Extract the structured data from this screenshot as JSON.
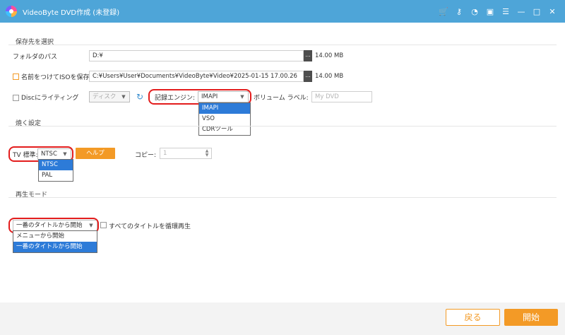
{
  "window": {
    "title": "VideoByte DVD作成 (未登録)",
    "titlebar_icons": [
      "cart-icon",
      "key-icon",
      "feedback-icon",
      "message-icon",
      "menu-icon",
      "minimize-icon",
      "maximize-icon",
      "close-icon"
    ]
  },
  "save_section": {
    "title": "保存先を選択",
    "folder_label": "フォルダのパス",
    "folder_value": "D:¥",
    "folder_size": "14.00 MB",
    "iso_label": "名前をつけてISOを保存",
    "iso_value": "C:¥Users¥User¥Documents¥VideoByte¥Video¥2025-01-15 17.00.26",
    "iso_size": "14.00 MB",
    "disc_label": "Discにライティング",
    "disc_dropdown": "ディスク",
    "engine_label": "記録エンジン:",
    "engine_selected": "IMAPI",
    "engine_options": [
      "IMAPI",
      "VSO",
      "CDRツール"
    ],
    "volume_label": "ボリューム ラベル:",
    "volume_placeholder": "My DVD",
    "browse_label": "..."
  },
  "burn_section": {
    "title": "焼く設定",
    "tv_label": "TV 標準:",
    "tv_selected": "NTSC",
    "tv_options": [
      "NTSC",
      "PAL"
    ],
    "help_label": "ヘルプ",
    "copy_label": "コピー:",
    "copy_value": "1"
  },
  "playback_section": {
    "title": "再生モード",
    "mode_selected": "一番のタイトルから開始",
    "mode_options": [
      "メニューから開始",
      "一番のタイトルから開始"
    ],
    "loop_label": "すべてのタイトルを循環再生"
  },
  "footer": {
    "back_label": "戻る",
    "start_label": "開始"
  },
  "colors": {
    "titlebar": "#4ea5d8",
    "accent": "#f39a26",
    "highlight": "#e31d1d",
    "selection": "#2d7bd8"
  }
}
